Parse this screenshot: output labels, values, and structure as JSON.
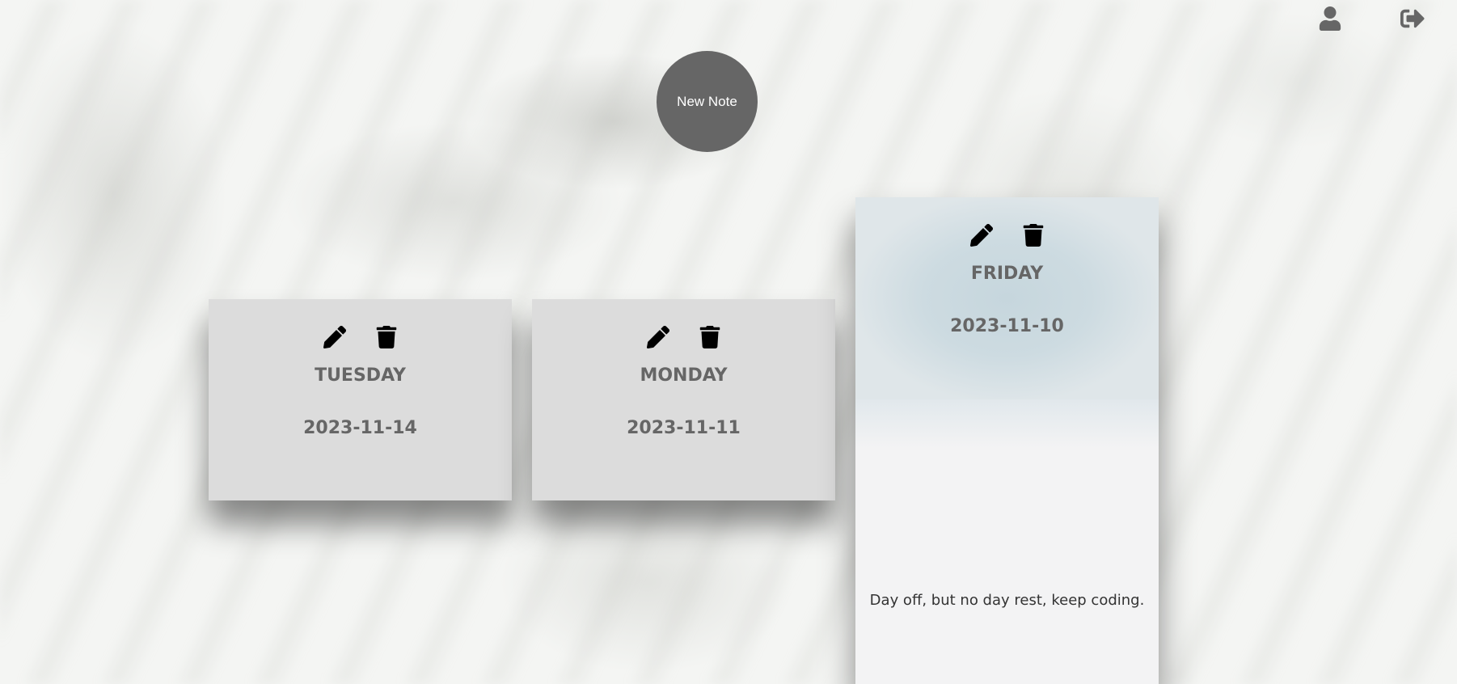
{
  "header": {
    "profile_icon": "user-icon",
    "logout_icon": "sign-out-icon"
  },
  "new_note_label": "New Note",
  "notes": [
    {
      "day": "TUESDAY",
      "date": "2023-11-14",
      "edit_icon": "pencil-icon",
      "delete_icon": "trash-icon"
    },
    {
      "day": "MONDAY",
      "date": "2023-11-11",
      "edit_icon": "pencil-icon",
      "delete_icon": "trash-icon"
    },
    {
      "day": "FRIDAY",
      "date": "2023-11-10",
      "content": "Day off, but no day rest, keep coding.",
      "edit_icon": "pencil-icon",
      "delete_icon": "trash-icon"
    }
  ],
  "colors": {
    "button_bg": "#666666",
    "card_bg": "#dcdcdc",
    "text_gray": "#666666",
    "expanded_header": "#c6d6dd"
  }
}
